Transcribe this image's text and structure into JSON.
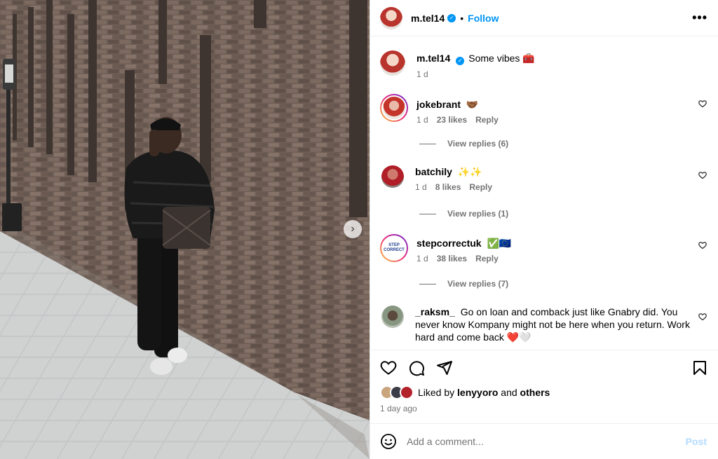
{
  "post": {
    "username": "m.tel14",
    "follow_label": "Follow",
    "dot": "•",
    "more_label": "•••",
    "caption": "Some vibes 🧰",
    "caption_time": "1 d"
  },
  "comments": [
    {
      "user": "jokebrant",
      "text": "🤝🏾",
      "time": "1 d",
      "likes": "23 likes",
      "reply": "Reply",
      "view_replies": "View replies (6)"
    },
    {
      "user": "batchily",
      "text": "✨✨",
      "time": "1 d",
      "likes": "8 likes",
      "reply": "Reply",
      "view_replies": "View replies (1)"
    },
    {
      "user": "stepcorrectuk",
      "text": "✅🇪🇺",
      "time": "1 d",
      "likes": "38 likes",
      "reply": "Reply",
      "view_replies": "View replies (7)"
    },
    {
      "user": "_raksm_",
      "text": "Go on loan and comback just like Gnabry did. You never know Kompany might not be here when you return. Work hard and come back ❤️🤍"
    }
  ],
  "likes": {
    "prefix": "Liked by",
    "user": "lenyyoro",
    "and": "and",
    "others": "others",
    "time_ago": "1 day ago"
  },
  "add_comment": {
    "placeholder": "Add a comment...",
    "post_label": "Post"
  },
  "stepcorrect_logo": "STEP CORRECT",
  "colors": {
    "accent": "#0095f6",
    "muted": "#737373",
    "post_disabled": "#b3dbff"
  }
}
